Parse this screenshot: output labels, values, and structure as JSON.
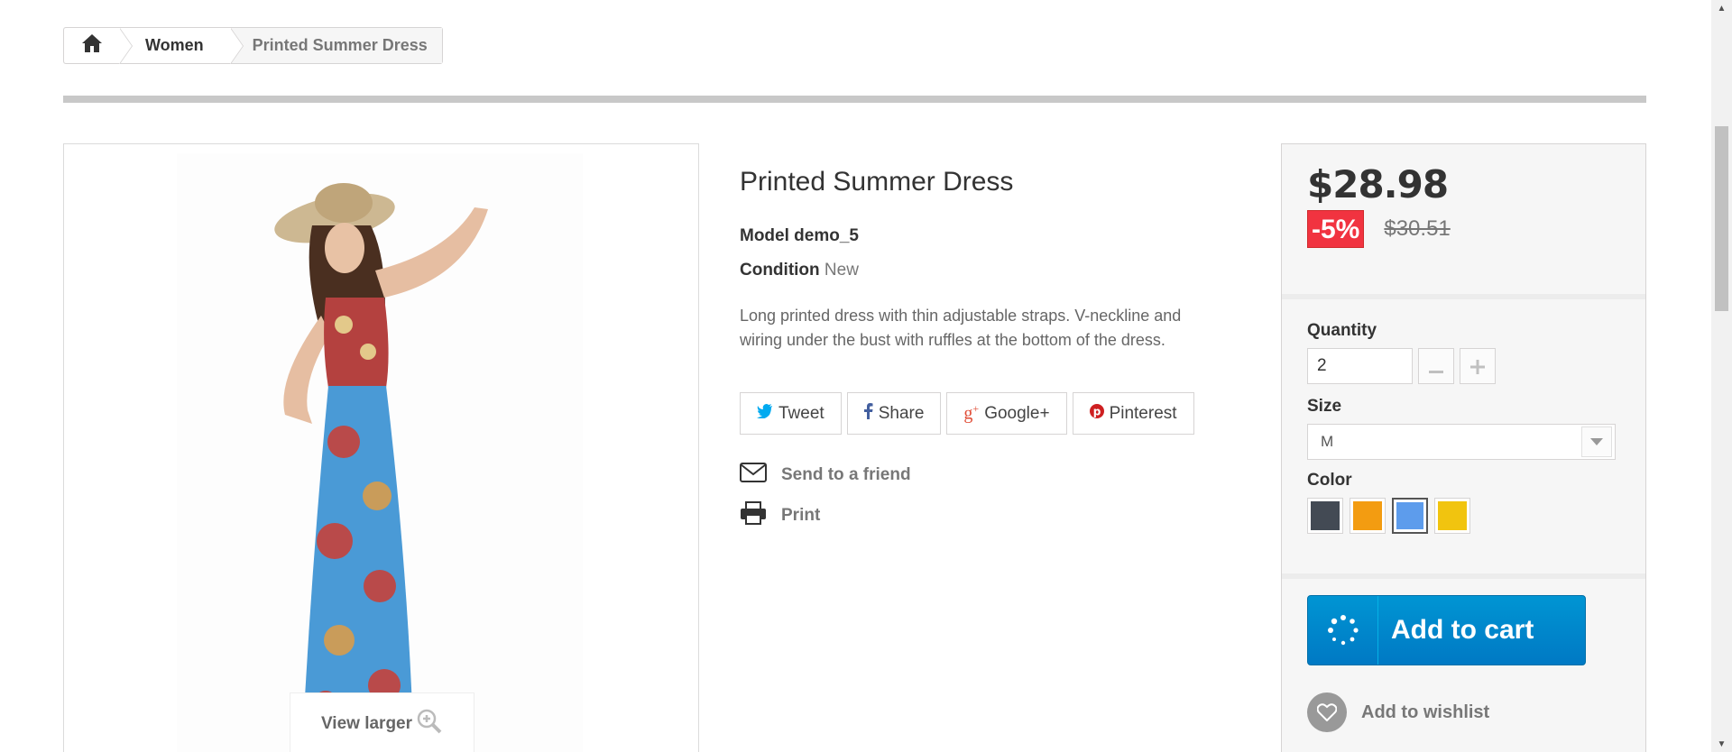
{
  "breadcrumb": {
    "home_icon": "home-icon",
    "items": [
      {
        "label": "Women"
      },
      {
        "label": "Printed Summer Dress"
      }
    ]
  },
  "image": {
    "view_larger_label": "View larger",
    "zoom_icon": "zoom-in-icon"
  },
  "product": {
    "title": "Printed Summer Dress",
    "model_label": "Model",
    "model_value": "demo_5",
    "condition_label": "Condition",
    "condition_value": "New",
    "description": "Long printed dress with thin adjustable straps. V-neckline and wiring under the bust with ruffles at the bottom of the dress."
  },
  "social": [
    {
      "label": "Tweet",
      "icon": "twitter-icon",
      "color": "#00aaf0"
    },
    {
      "label": "Share",
      "icon": "facebook-icon",
      "color": "#435f9f"
    },
    {
      "label": "Google+",
      "icon": "google-plus-icon",
      "color": "#e04b34"
    },
    {
      "label": "Pinterest",
      "icon": "pinterest-icon",
      "color": "#ce1f21"
    }
  ],
  "actions": {
    "send_to_friend": "Send to a friend",
    "print": "Print"
  },
  "buy": {
    "price": "$28.98",
    "discount": "-5%",
    "old_price": "$30.51",
    "quantity_label": "Quantity",
    "quantity_value": "2",
    "size_label": "Size",
    "size_value": "M",
    "color_label": "Color",
    "colors": [
      "#434a54",
      "#f39c11",
      "#5d9cec",
      "#f1c40f"
    ],
    "selected_color_index": 2,
    "add_to_cart": "Add to cart",
    "add_to_wishlist": "Add to wishlist",
    "accent": "#0079c4",
    "discount_color": "#f13340"
  }
}
